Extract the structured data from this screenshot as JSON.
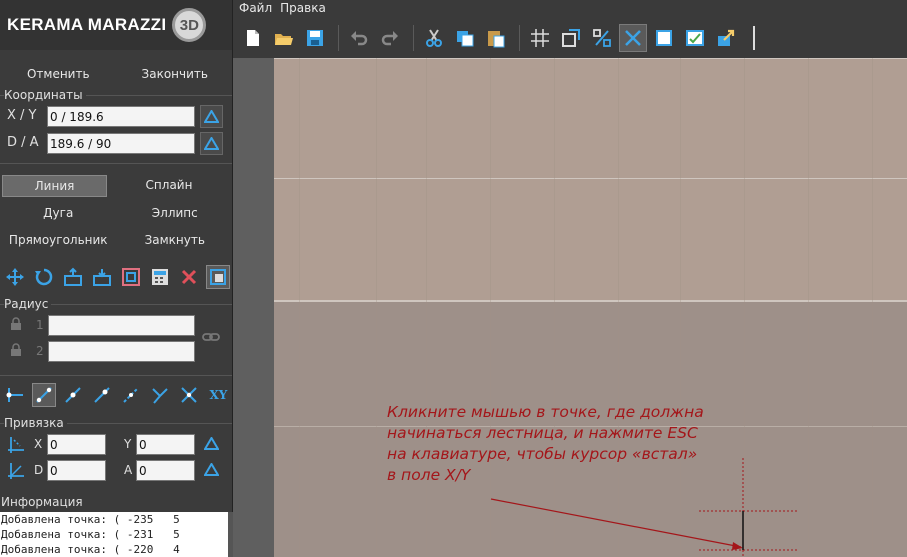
{
  "logo": {
    "brand": "KERAMA MARAZZI",
    "badge": "3D"
  },
  "menu": {
    "items": [
      "Файл",
      "Правка"
    ]
  },
  "actions": {
    "undo_label": "Отменить",
    "finish_label": "Закончить"
  },
  "coords": {
    "title": "Координаты",
    "xy_label": "X / Y",
    "xy_value": "0 / 189.6",
    "da_label": "D / A",
    "da_value": "189.6 / 90"
  },
  "shapes": {
    "line": "Линия",
    "spline": "Сплайн",
    "arc": "Дуга",
    "ellipse": "Эллипс",
    "rectangle": "Прямоугольник",
    "close": "Замкнуть"
  },
  "radius": {
    "title": "Радиус",
    "n1": "1",
    "n2": "2",
    "v1": "",
    "v2": ""
  },
  "snap": {
    "title": "Привязка",
    "x_label": "X",
    "x_value": "0",
    "y_label": "Y",
    "y_value": "0",
    "d_label": "D",
    "d_value": "0",
    "a_label": "A",
    "a_value": "0",
    "xy_button": "XY"
  },
  "info": {
    "title": "Информация",
    "lines": [
      "Добавлена точка: ( -235   5",
      "Добавлена точка: ( -231   5",
      "Добавлена точка: ( -220   4"
    ]
  },
  "hint": {
    "line1": "Кликните мышью в точке, где должна",
    "line2": "начинаться лестница, и нажмите ESC",
    "line3": "на клавиатуре, чтобы курсор «встал»",
    "line4": "в поле X/Y",
    "color": "#a4161a"
  }
}
